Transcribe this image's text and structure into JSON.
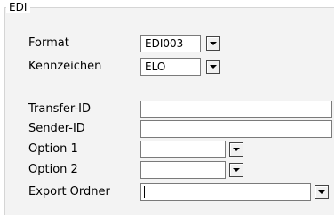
{
  "group": {
    "title": "EDI"
  },
  "format": {
    "label": "Format",
    "value": "EDI003",
    "icon": "chevron-down-icon"
  },
  "kennzeichen": {
    "label": "Kennzeichen",
    "value": "ELO",
    "icon": "chevron-down-icon"
  },
  "transfer_id": {
    "label": "Transfer-ID",
    "value": ""
  },
  "sender_id": {
    "label": "Sender-ID",
    "value": ""
  },
  "option1": {
    "label": "Option 1",
    "value": "",
    "icon": "chevron-down-icon"
  },
  "option2": {
    "label": "Option 2",
    "value": "",
    "icon": "chevron-down-icon"
  },
  "export_ordner": {
    "label": "Export Ordner",
    "value": "",
    "icon": "chevron-down-icon"
  }
}
